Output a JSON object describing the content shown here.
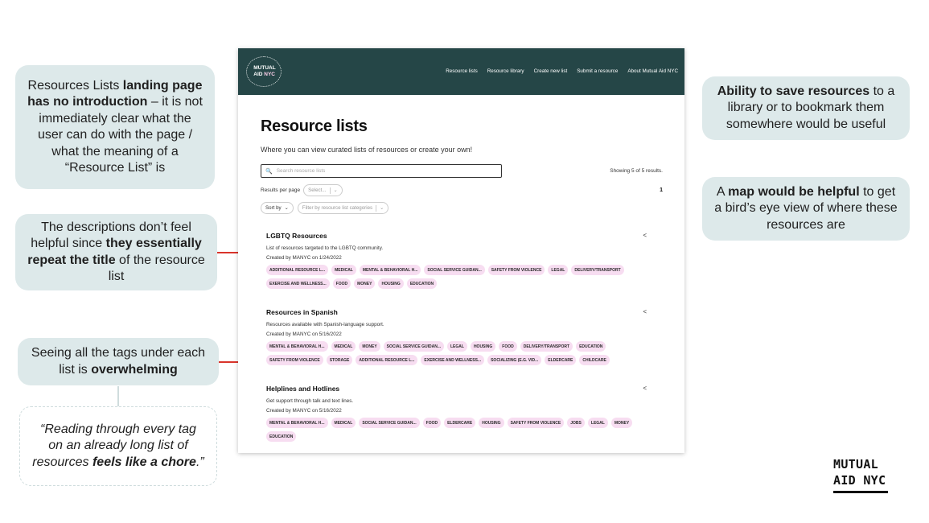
{
  "callouts": {
    "c1": {
      "p1": "Resources Lists ",
      "b1": "landing page has no introduction",
      "p2": " – it is not immediately clear what the user can do with the page / what the meaning of a “Resource List” is"
    },
    "c2": {
      "p1": "The descriptions don’t feel helpful since ",
      "b1": "they essentially repeat the title",
      "p2": " of the resource list"
    },
    "c3": {
      "p1": "Seeing all the tags under each list is ",
      "b1": "overwhelming"
    },
    "c4": {
      "b1": "Ability to save resources",
      "p1": " to a library or to bookmark them somewhere would be useful"
    },
    "c5": {
      "p1": "A ",
      "b1": "map would be helpful",
      "p2": " to get a bird’s eye view of where these resources are"
    },
    "quote": {
      "p1": "“Reading through every tag on an already long list of resources ",
      "b1": "feels like a chore",
      "p2": ".”"
    }
  },
  "brand_logo": {
    "line1": "MUTUAL",
    "line2": "AID NYC"
  },
  "site": {
    "logo": {
      "line1": "MUTUAL",
      "line2a": "AID",
      "line2b": "NYC"
    },
    "nav": [
      "Resource lists",
      "Resource library",
      "Create new list",
      "Submit a resource",
      "About Mutual Aid NYC"
    ],
    "title": "Resource lists",
    "subtitle": "Where you can view curated lists of resources or create your own!",
    "search_placeholder": "Search resource lists",
    "showing": "Showing 5 of 5 results.",
    "results_per_page_label": "Results per page",
    "select_placeholder": "Select...",
    "page_number": "1",
    "sort_label": "Sort by",
    "filter_placeholder": "Filter by resource list categories",
    "lists": [
      {
        "title": "LGBTQ Resources",
        "description": "List of resources targeted to the LGBTQ community.",
        "meta": "Created by MANYC on 1/24/2022",
        "tags": [
          "ADDITIONAL RESOURCE L...",
          "MEDICAL",
          "MENTAL & BEHAVIORAL H...",
          "SOCIAL SERVICE GUIDAN...",
          "SAFETY FROM VIOLENCE",
          "LEGAL",
          "DELIVERY/TRANSPORT",
          "EXERCISE AND WELLNESS...",
          "FOOD",
          "MONEY",
          "HOUSING",
          "EDUCATION"
        ]
      },
      {
        "title": "Resources in Spanish",
        "description": "Resources available with Spanish-language support.",
        "meta": "Created by MANYC on 5/16/2022",
        "tags": [
          "MENTAL & BEHAVIORAL H...",
          "MEDICAL",
          "MONEY",
          "SOCIAL SERVICE GUIDAN...",
          "LEGAL",
          "HOUSING",
          "FOOD",
          "DELIVERY/TRANSPORT",
          "EDUCATION",
          "SAFETY FROM VIOLENCE",
          "STORAGE",
          "ADDITIONAL RESOURCE L...",
          "EXERCISE AND WELLNESS...",
          "SOCIALIZING (E.G. VID...",
          "ELDERCARE",
          "CHILDCARE"
        ]
      },
      {
        "title": "Helplines and Hotlines",
        "description": "Get support through talk and text lines.",
        "meta": "Created by MANYC on 5/16/2022",
        "tags": [
          "MENTAL & BEHAVIORAL H...",
          "MEDICAL",
          "SOCIAL SERVICE GUIDAN...",
          "FOOD",
          "ELDERCARE",
          "HOUSING",
          "SAFETY FROM VIOLENCE",
          "JOBS",
          "LEGAL",
          "MONEY",
          "EDUCATION"
        ]
      }
    ]
  },
  "colors": {
    "header_bg": "#254647",
    "callout_bg": "#dde9ea",
    "arrow": "#d9342b",
    "tag_bg": "#f7ddf1"
  }
}
